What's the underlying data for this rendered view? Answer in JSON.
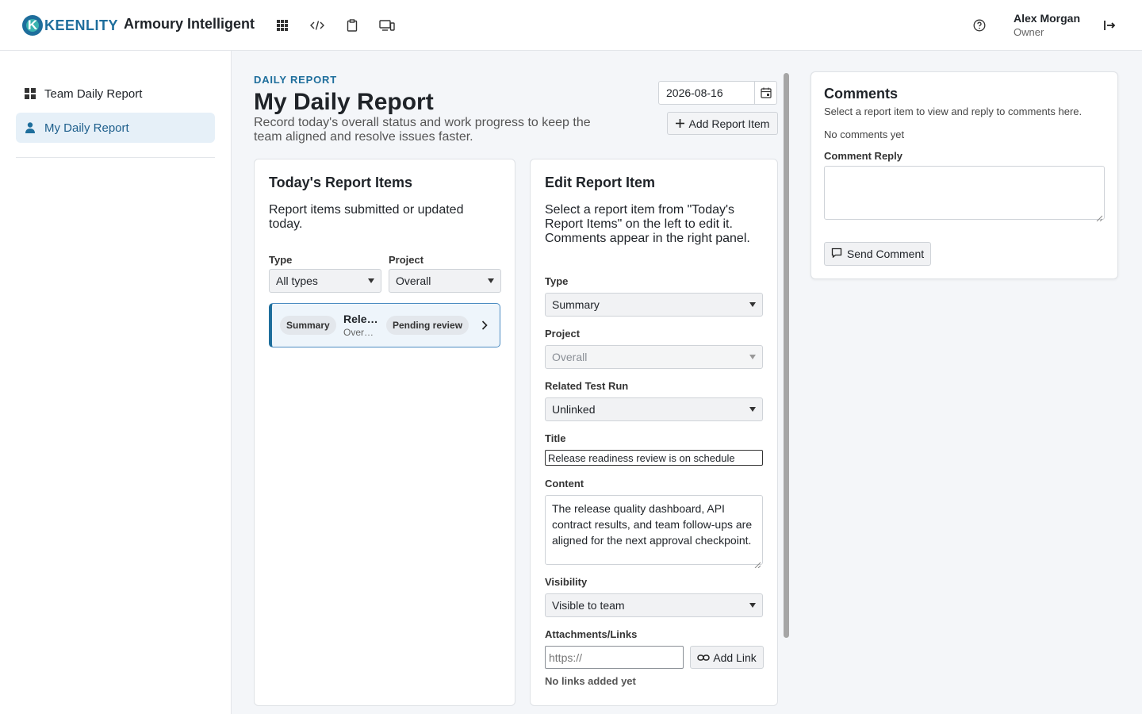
{
  "brand": {
    "logo_letter": "K",
    "logo_text": "KEENLITY",
    "app_title": "Armoury Intelligent",
    "accent": "#1e6e9c"
  },
  "topbar": {
    "icons": [
      "grid-icon",
      "code-icon",
      "clipboard-icon",
      "devices-icon"
    ],
    "help_icon": "help-icon",
    "user": {
      "name": "Alex Morgan",
      "role": "Owner"
    },
    "logout_icon": "logout-icon"
  },
  "sidebar": {
    "items": [
      {
        "label": "Team Daily Report",
        "icon": "grid-icon",
        "active": false
      },
      {
        "label": "My Daily Report",
        "icon": "person-icon",
        "active": true
      }
    ]
  },
  "header": {
    "overline": "DAILY REPORT",
    "title": "My Daily Report",
    "description": "Record today's overall status and work progress to keep the team aligned and resolve issues faster.",
    "date": "2026-08-16",
    "add_button": "Add Report Item"
  },
  "items_panel": {
    "title": "Today's Report Items",
    "description": "Report items submitted or updated today.",
    "type_label": "Type",
    "type_value": "All types",
    "project_label": "Project",
    "project_value": "Overall",
    "rows": [
      {
        "type": "Summary",
        "title": "Rele…",
        "subtitle": "Over…",
        "status": "Pending review"
      }
    ]
  },
  "edit_panel": {
    "title": "Edit Report Item",
    "description": "Select a report item from \"Today's Report Items\" on the left to edit it. Comments appear in the right panel.",
    "type_label": "Type",
    "type_value": "Summary",
    "project_label": "Project",
    "project_value": "Overall",
    "test_run_label": "Related Test Run",
    "test_run_value": "Unlinked",
    "title_label": "Title",
    "title_value": "Release readiness review is on schedule",
    "content_label": "Content",
    "content_value": "The release quality dashboard, API contract results, and team follow-ups are aligned for the next approval checkpoint.",
    "visibility_label": "Visibility",
    "visibility_value": "Visible to team",
    "attachments_label": "Attachments/Links",
    "link_placeholder": "https://",
    "add_link_button": "Add Link",
    "no_links": "No links added yet"
  },
  "comments": {
    "title": "Comments",
    "subtitle": "Select a report item to view and reply to comments here.",
    "empty": "No comments yet",
    "reply_label": "Comment Reply",
    "send_button": "Send Comment"
  }
}
